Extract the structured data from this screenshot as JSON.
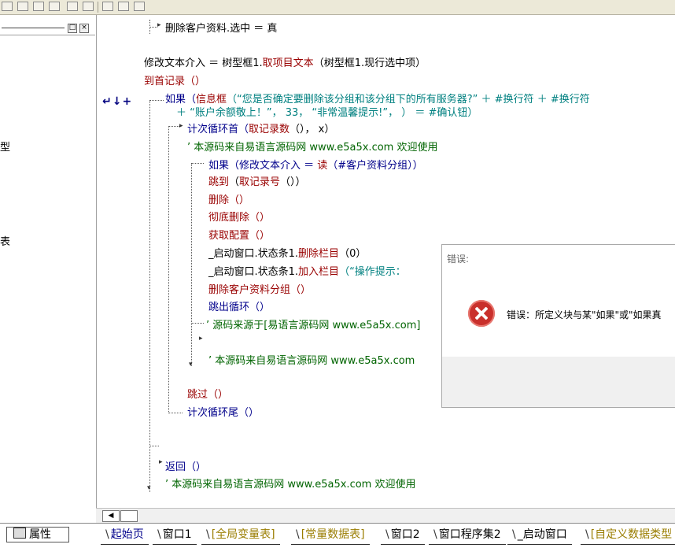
{
  "window": {
    "panel_close": "×",
    "panel_restore": "□"
  },
  "left_panel": {
    "frag_type": "型",
    "frag_table": "表"
  },
  "gutter": {
    "marker": "↵↓+"
  },
  "code": {
    "l1": {
      "text": "删除客户资料.选中 ＝ 真"
    },
    "l2": {
      "a": "修改文本介入 ＝ 树型框1.",
      "b": "取项目文本",
      "c": "（树型框1.现行选中项）"
    },
    "l3": {
      "text": "到首记录（）"
    },
    "l4": {
      "a": "如果（",
      "b": "信息框",
      "c": "（“您是否确定要删除该分组和该分组下的所有服务器?” ＋ #换行符 ＋ #换行符"
    },
    "l5": {
      "text": "＋ “账户余额敬上！”， 33， “非常温馨提示!”， ） ＝ #确认钮）"
    },
    "l6": {
      "a": "计次循环首（",
      "b": "取记录数",
      "c": "（）， x）"
    },
    "l7": {
      "text": "’ 本源码来自易语言源码网 www.e5a5x.com  欢迎使用"
    },
    "l8": {
      "a": "如果（修改文本介入 ＝ ",
      "b": "读",
      "c": "（#客户资料分组））"
    },
    "l9": {
      "a": "跳到",
      "b": "（",
      "c": "取记录号",
      "d": "（））"
    },
    "l10": {
      "text": "删除（）"
    },
    "l11": {
      "text": "彻底删除（）"
    },
    "l12": {
      "text": "获取配置（）"
    },
    "l13": {
      "a": "_启动窗口.状态条1.",
      "b": "删除栏目",
      "c": "（0）"
    },
    "l14": {
      "a": "_启动窗口.状态条1.",
      "b": "加入栏目",
      "c": "（“操作提示："
    },
    "l15": {
      "text": "删除客户资料分组（）"
    },
    "l16": {
      "text": "跳出循环（）"
    },
    "l17": {
      "text": "’ 源码来源于[易语言源码网 www.e5a5x.com]"
    },
    "l18": {
      "text": "’ 本源码来自易语言源码网 www.e5a5x.com"
    },
    "l19": {
      "text": "跳过（）"
    },
    "l20": {
      "text": "计次循环尾（）"
    },
    "l21": {
      "text": "返回（）"
    },
    "l22": {
      "text": "’ 本源码来自易语言源码网 www.e5a5x.com  欢迎使用"
    }
  },
  "dialog": {
    "title": "错误:",
    "message": "错误：所定义块与某\"如果\"或\"如果真"
  },
  "bottom": {
    "props_label": "属性",
    "tabs": [
      "起始页",
      "窗口1",
      "[全局变量表]",
      "[常量数据表]",
      "窗口2",
      "窗口程序集2",
      "_启动窗口",
      "[自定义数据类型"
    ]
  },
  "colors": {
    "keyword_red": "#990000",
    "string_teal": "#008080",
    "comment_green": "#006400",
    "func_blue": "#00008b",
    "error_red": "#c9302c"
  }
}
